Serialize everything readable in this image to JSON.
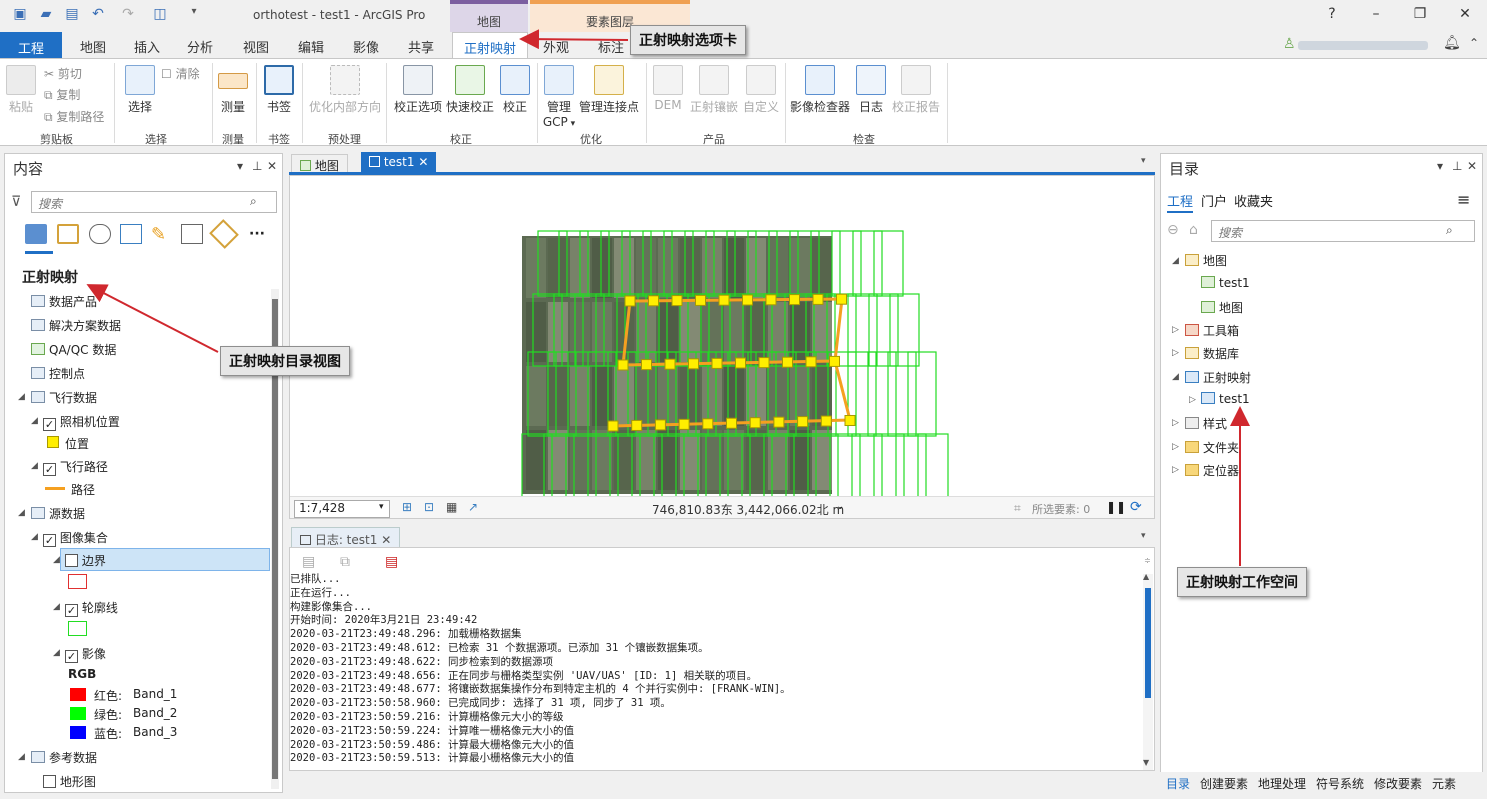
{
  "window": {
    "title": "orthotest - test1 - ArcGIS Pro",
    "help": "?",
    "minimize": "–",
    "restore": "❐",
    "close": "✕"
  },
  "context_headers": {
    "map": "地图",
    "feature_layer": "要素图层"
  },
  "tabs": {
    "project": "工程",
    "map": "地图",
    "insert": "插入",
    "analysis": "分析",
    "view": "视图",
    "edit": "编辑",
    "imagery": "影像",
    "share": "共享",
    "ortho": "正射映射",
    "appearance": "外观",
    "label": "标注"
  },
  "ribbon": {
    "clipboard": {
      "paste": "粘贴",
      "cut": "剪切",
      "copy": "复制",
      "copy_path": "复制路径",
      "group": "剪贴板"
    },
    "selection": {
      "select": "选择",
      "clear": "清除",
      "group": "选择"
    },
    "measure": {
      "label": "测量",
      "group": "测量"
    },
    "bookmarks": {
      "label": "书签",
      "group": "书签"
    },
    "preprocess": {
      "optimize": "优化内部方向",
      "group": "预处理"
    },
    "adjust": {
      "options": "校正选项",
      "quick": "快速校正",
      "adjust": "校正",
      "group": "校正"
    },
    "refine": {
      "manage_gcp": "管理",
      "gcp": "GCP",
      "manage_tie": "管理连接点",
      "group": "优化"
    },
    "product": {
      "dem": "DEM",
      "mosaic": "正射镶嵌",
      "custom": "自定义",
      "group": "产品"
    },
    "review": {
      "inspector": "影像检查器",
      "log": "日志",
      "report": "校正报告",
      "group": "检查"
    }
  },
  "contents": {
    "title": "内容",
    "search_placeholder": "搜索",
    "heading": "正射映射",
    "items": {
      "data_products": "数据产品",
      "solution_data": "解决方案数据",
      "qaqc": "QA/QC 数据",
      "control_points": "控制点",
      "flight_data": "飞行数据",
      "camera_locations": "照相机位置",
      "position": "位置",
      "flight_path": "飞行路径",
      "path": "路径",
      "source_data": "源数据",
      "image_collection": "图像集合",
      "boundary": "边界",
      "footprint": "轮廓线",
      "image": "影像",
      "rgb": "RGB",
      "red": "红色:",
      "green": "绿色:",
      "blue": "蓝色:",
      "band1": "Band_1",
      "band2": "Band_2",
      "band3": "Band_3",
      "reference_data": "参考数据",
      "terrain": "地形图"
    }
  },
  "map_tabs": {
    "map": "地图",
    "test1": "test1"
  },
  "map_status": {
    "scale": "1:7,428",
    "coords": "746,810.83东 3,442,066.02北 m",
    "selected": "所选要素: 0"
  },
  "log": {
    "tab": "日志: test1",
    "lines": [
      "已排队...",
      "正在运行...",
      "构建影像集合...",
      "开始时间: 2020年3月21日 23:49:42",
      "2020-03-21T23:49:48.296: 加载栅格数据集",
      "2020-03-21T23:49:48.612: 已检索 31 个数据源项。已添加 31 个镶嵌数据集项。",
      "2020-03-21T23:49:48.622: 同步检索到的数据源项",
      "2020-03-21T23:49:48.656: 正在同步与栅格类型实例 'UAV/UAS' [ID: 1] 相关联的项目。",
      "2020-03-21T23:49:48.677: 将镶嵌数据集操作分布到特定主机的 4 个并行实例中: [FRANK-WIN]。",
      "2020-03-21T23:50:58.960: 已完成同步: 选择了 31 项, 同步了 31 项。",
      "2020-03-21T23:50:59.216: 计算栅格像元大小的等级",
      "2020-03-21T23:50:59.224: 计算唯一栅格像元大小的值",
      "2020-03-21T23:50:59.486: 计算最大栅格像元大小的值",
      "2020-03-21T23:50:59.513: 计算最小栅格像元大小的值"
    ]
  },
  "catalog": {
    "title": "目录",
    "tabs": {
      "project": "工程",
      "portal": "门户",
      "favorites": "收藏夹"
    },
    "search_placeholder": "搜索",
    "tree": {
      "maps": "地图",
      "test1": "test1",
      "map": "地图",
      "toolboxes": "工具箱",
      "databases": "数据库",
      "ortho": "正射映射",
      "ortho_test1": "test1",
      "styles": "样式",
      "folders": "文件夹",
      "locators": "定位器"
    },
    "bottom_tabs": {
      "catalog": "目录",
      "create": "创建要素",
      "geoprocessing": "地理处理",
      "symbology": "符号系统",
      "modify": "修改要素",
      "elements": "元素"
    }
  },
  "callouts": {
    "tab": "正射映射选项卡",
    "catalog_view": "正射映射目录视图",
    "workspace": "正射映射工作空间"
  },
  "colors": {
    "accent": "#1f6fc5",
    "ortho_ctx": "#7c5fa0",
    "feature_ctx": "#f0a050",
    "footprint": "#22dd22",
    "camera": "#ffee00",
    "path": "#f5a020",
    "arrow": "#d0282e"
  }
}
